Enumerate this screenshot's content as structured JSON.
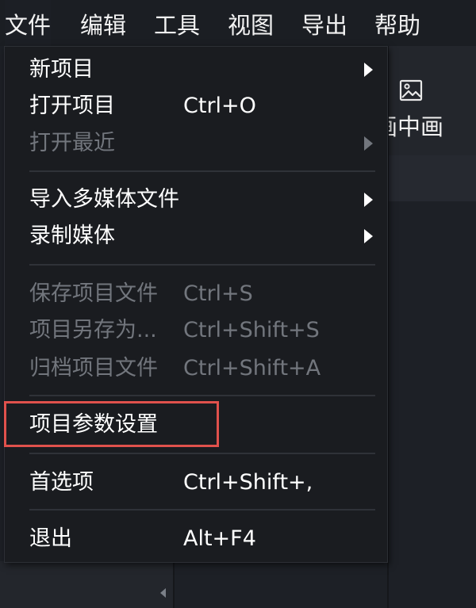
{
  "menubar": {
    "items": [
      {
        "label": "文件"
      },
      {
        "label": "编辑"
      },
      {
        "label": "工具"
      },
      {
        "label": "视图"
      },
      {
        "label": "导出"
      },
      {
        "label": "帮助"
      }
    ]
  },
  "background": {
    "toolbar": {
      "icon": "image-icon",
      "label": "画中画"
    }
  },
  "file_menu": {
    "items": [
      {
        "label": "新项目",
        "shortcut": "",
        "submenu": true,
        "enabled": true
      },
      {
        "label": "打开项目",
        "shortcut": "Ctrl+O",
        "submenu": false,
        "enabled": true
      },
      {
        "label": "打开最近",
        "shortcut": "",
        "submenu": true,
        "enabled": false
      },
      {
        "label": "导入多媒体文件",
        "shortcut": "",
        "submenu": true,
        "enabled": true
      },
      {
        "label": "录制媒体",
        "shortcut": "",
        "submenu": true,
        "enabled": true
      },
      {
        "label": "保存项目文件",
        "shortcut": "Ctrl+S",
        "submenu": false,
        "enabled": false
      },
      {
        "label": "项目另存为...",
        "shortcut": "Ctrl+Shift+S",
        "submenu": false,
        "enabled": false
      },
      {
        "label": "归档项目文件",
        "shortcut": "Ctrl+Shift+A",
        "submenu": false,
        "enabled": false
      },
      {
        "label": "项目参数设置",
        "shortcut": "",
        "submenu": false,
        "enabled": true,
        "highlighted": true
      },
      {
        "label": "首选项",
        "shortcut": "Ctrl+Shift+,",
        "submenu": false,
        "enabled": true
      },
      {
        "label": "退出",
        "shortcut": "Alt+F4",
        "submenu": false,
        "enabled": true
      }
    ]
  },
  "colors": {
    "menu_background": "#1a1c20",
    "text": "#ffffff",
    "disabled_text": "#72767d",
    "highlight_border": "#e0514c"
  }
}
